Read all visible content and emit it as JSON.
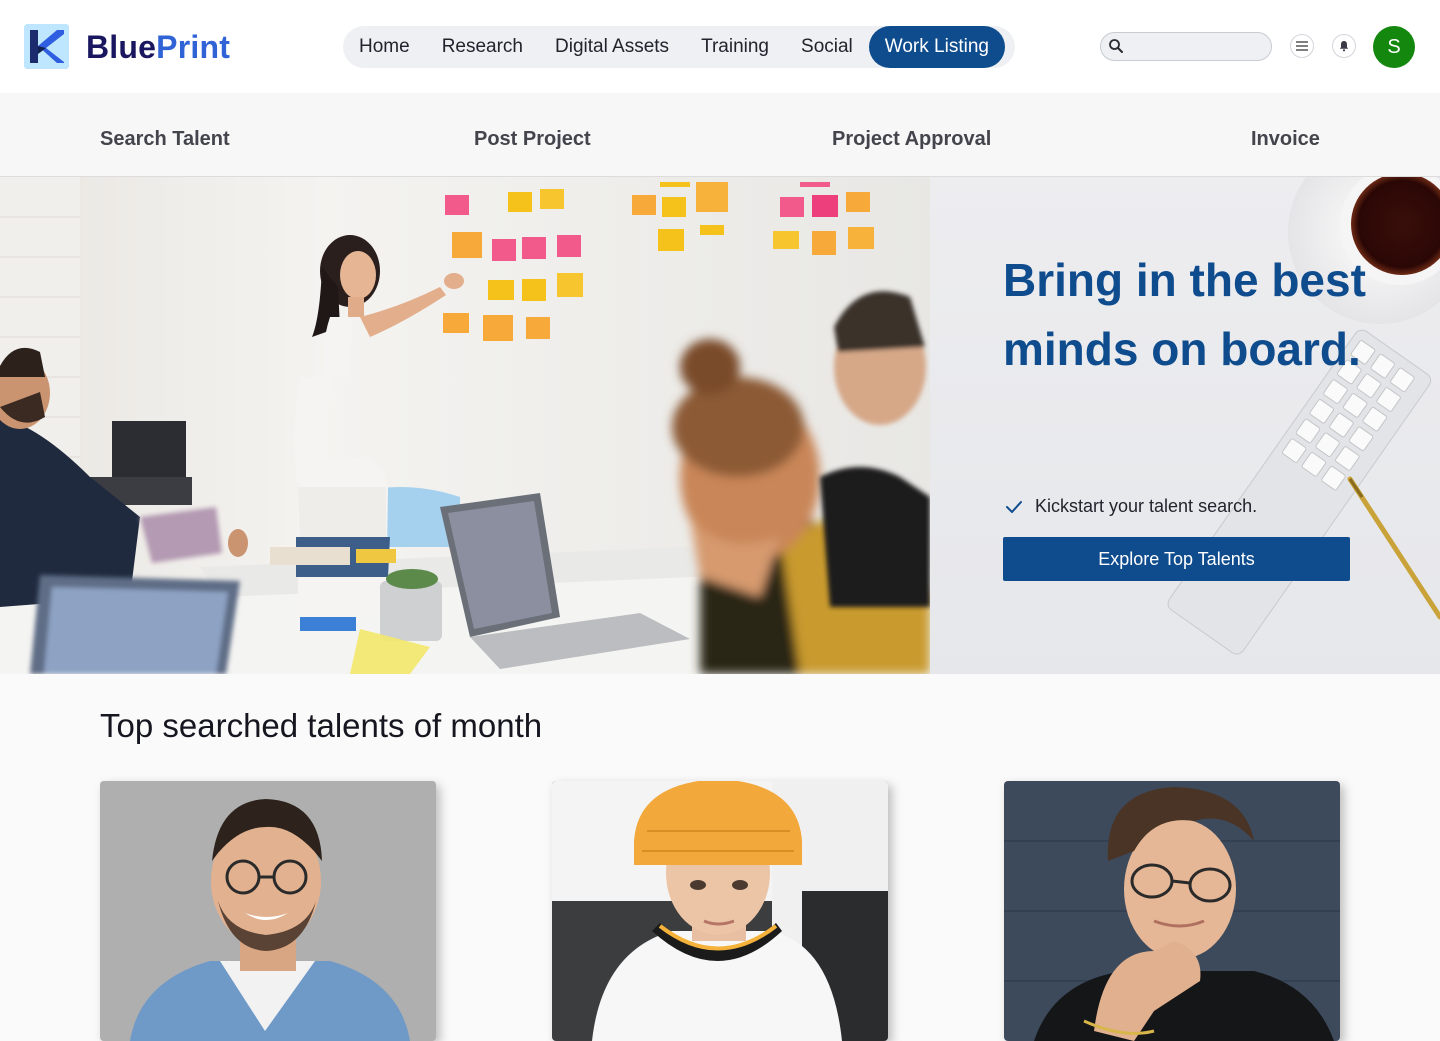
{
  "brand": {
    "name_part1": "Blue",
    "name_part2": "Print",
    "logo_icon": "blueprint-logo-icon"
  },
  "main_nav": [
    {
      "label": "Home",
      "active": false
    },
    {
      "label": "Research",
      "active": false
    },
    {
      "label": "Digital Assets",
      "active": false
    },
    {
      "label": "Training",
      "active": false
    },
    {
      "label": "Social",
      "active": false
    },
    {
      "label": "Work Listing",
      "active": true
    }
  ],
  "search": {
    "placeholder": "",
    "value": "",
    "icon": "search-icon"
  },
  "header_icons": [
    "menu-list-icon",
    "bell-icon"
  ],
  "user": {
    "initial": "S",
    "avatar_color": "#14870f"
  },
  "sub_nav": [
    "Search Talent",
    "Post Project",
    "Project Approval",
    "Invoice"
  ],
  "hero": {
    "headline": "Bring in the best minds on board.",
    "checklist": [
      "Kickstart your talent search."
    ],
    "cta_label": "Explore Top Talents",
    "photo": "team-meeting-photo",
    "decoration": "coffee-keyboard-pen-decoration"
  },
  "talents": {
    "title": "Top searched talents of month",
    "cards": [
      {
        "photo": "talent-photo-1"
      },
      {
        "photo": "talent-photo-2"
      },
      {
        "photo": "talent-photo-3"
      }
    ]
  },
  "colors": {
    "primary": "#0f4c8e",
    "nav_bg": "#eef0f3",
    "avatar": "#14870f"
  }
}
